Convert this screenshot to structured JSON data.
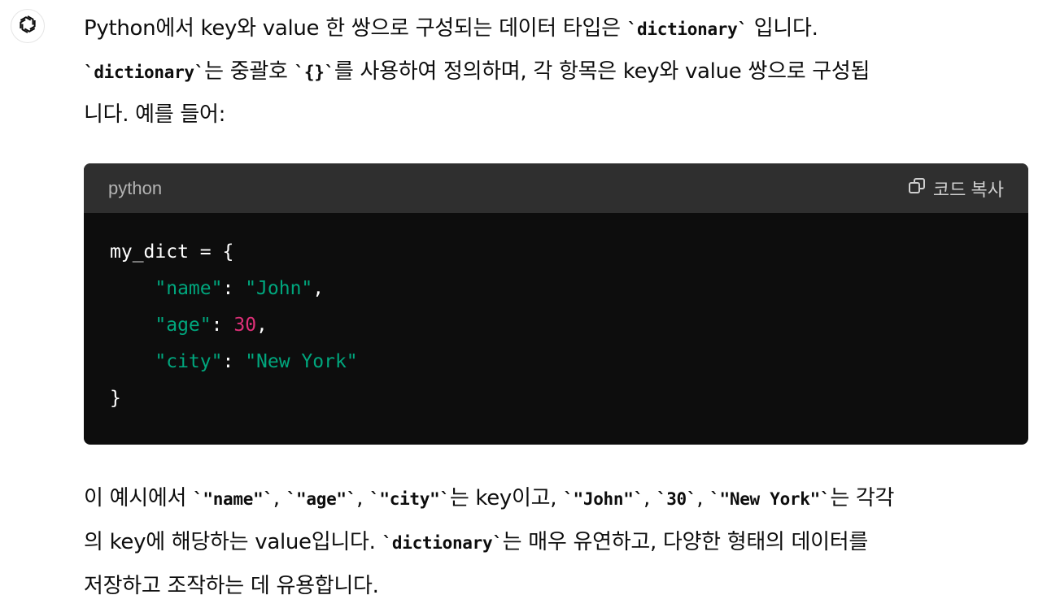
{
  "message": {
    "intro": {
      "l1a": "Python에서 key와 value 한 쌍으로 구성되는 데이터 타입은 ",
      "l1code": "`dictionary`",
      "l1b": " 입니다.",
      "l2code1": "`dictionary`",
      "l2a": "는 중괄호 ",
      "l2code2": "`{}`",
      "l2b": "를 사용하여 정의하며, 각 항목은 key와 value 쌍으로 구성됩",
      "l3": "니다. 예를 들어:"
    },
    "code_block": {
      "language": "python",
      "copy_label": "코드 복사",
      "lines": {
        "l1": "my_dict = {",
        "l2_key": "\"name\"",
        "l2_sep": ": ",
        "l2_val": "\"John\"",
        "l2_end": ",",
        "l3_key": "\"age\"",
        "l3_sep": ": ",
        "l3_val": "30",
        "l3_end": ",",
        "l4_key": "\"city\"",
        "l4_sep": ": ",
        "l4_val": "\"New York\"",
        "l5": "}"
      }
    },
    "outro": {
      "l1a": "이 예시에서 ",
      "c1": "`\"name\"`",
      "s1": ", ",
      "c2": "`\"age\"`",
      "s2": ", ",
      "c3": "`\"city\"`",
      "l1b": "는 key이고, ",
      "c4": "`\"John\"`",
      "s3": ", ",
      "c5": "`30`",
      "s4": ", ",
      "c6": "`\"New York\"`",
      "l1c": "는 각각",
      "l2a": "의 key에 해당하는 value입니다. ",
      "c7": "`dictionary`",
      "l2b": "는 매우 유연하고, 다양한 형태의 데이터를",
      "l3": "저장하고 조작하는 데 유용합니다."
    }
  },
  "icons": {
    "avatar": "openai-logo-icon",
    "copy": "copy-icon"
  },
  "colors": {
    "code_bg": "#0d0d0d",
    "code_header_bg": "#2f2f2f",
    "string": "#00a67d",
    "number": "#df3079"
  }
}
